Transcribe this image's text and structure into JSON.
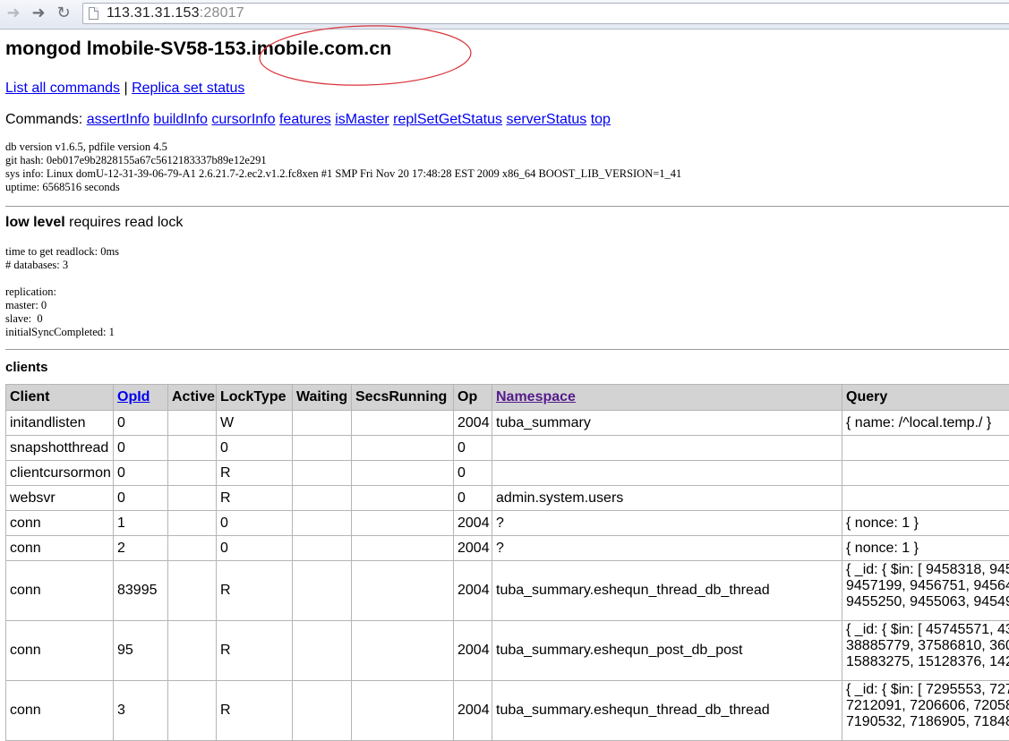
{
  "browser": {
    "url_host": "113.31.31.153",
    "url_port": ":28017",
    "icons": [
      "back-arrow-icon",
      "forward-arrow-icon",
      "reload-icon",
      "page-icon"
    ]
  },
  "page": {
    "title": "mongod lmobile-SV58-153.imobile.com.cn",
    "links": {
      "list_all_commands": "List all commands",
      "separator": " | ",
      "replica_set_status": "Replica set status"
    },
    "commands_label": "Commands: ",
    "commands": [
      "assertInfo",
      "buildInfo",
      "cursorInfo",
      "features",
      "isMaster",
      "replSetGetStatus",
      "serverStatus",
      "top"
    ],
    "sysinfo": "db version v1.6.5, pdfile version 4.5\ngit hash: 0eb017e9b2828155a67c5612183337b89e12e291\nsys info: Linux domU-12-31-39-06-79-A1 2.6.21.7-2.ec2.v1.2.fc8xen #1 SMP Fri Nov 20 17:48:28 EST 2009 x86_64 BOOST_LIB_VERSION=1_41\nuptime: 6568516 seconds",
    "low_level_bold": "low level",
    "low_level_rest": " requires read lock",
    "lockinfo": "time to get readlock: 0ms\n# databases: 3\n\nreplication:\nmaster: 0\nslave:  0\ninitialSyncCompleted: 1",
    "clients_title": "clients"
  },
  "clients_table": {
    "headers": {
      "client": "Client",
      "opid": "OpId",
      "active": "Active",
      "locktype": "LockType",
      "waiting": "Waiting",
      "secsrunning": "SecsRunning",
      "op": "Op",
      "namespace": "Namespace",
      "query": "Query"
    },
    "rows": [
      {
        "client": "initandlisten",
        "opid": "0",
        "active": "",
        "locktype": "W",
        "waiting": "",
        "secsrunning": "",
        "op": "2004",
        "namespace": "tuba_summary",
        "query": "{ name: /^local.temp./ }"
      },
      {
        "client": "snapshotthread",
        "opid": "0",
        "active": "",
        "locktype": "0",
        "waiting": "",
        "secsrunning": "",
        "op": "0",
        "namespace": "",
        "query": ""
      },
      {
        "client": "clientcursormon",
        "opid": "0",
        "active": "",
        "locktype": "R",
        "waiting": "",
        "secsrunning": "",
        "op": "0",
        "namespace": "",
        "query": ""
      },
      {
        "client": "websvr",
        "opid": "0",
        "active": "",
        "locktype": "R",
        "waiting": "",
        "secsrunning": "",
        "op": "0",
        "namespace": "admin.system.users",
        "query": ""
      },
      {
        "client": "conn",
        "opid": "1",
        "active": "",
        "locktype": "0",
        "waiting": "",
        "secsrunning": "",
        "op": "2004",
        "namespace": "?",
        "query": "{ nonce: 1 }"
      },
      {
        "client": "conn",
        "opid": "2",
        "active": "",
        "locktype": "0",
        "waiting": "",
        "secsrunning": "",
        "op": "2004",
        "namespace": "?",
        "query": "{ nonce: 1 }"
      },
      {
        "client": "conn",
        "opid": "83995",
        "active": "",
        "locktype": "R",
        "waiting": "",
        "secsrunning": "",
        "op": "2004",
        "namespace": "tuba_summary.eshequn_thread_db_thread",
        "query": "{ _id: { $in: [ 9458318, 945\n9457199, 9456751, 94564\n9455250, 9455063, 94549"
      },
      {
        "client": "conn",
        "opid": "95",
        "active": "",
        "locktype": "R",
        "waiting": "",
        "secsrunning": "",
        "op": "2004",
        "namespace": "tuba_summary.eshequn_post_db_post",
        "query": "{ _id: { $in: [ 45745571, 43\n38885779, 37586810, 360\n15883275, 15128376, 142"
      },
      {
        "client": "conn",
        "opid": "3",
        "active": "",
        "locktype": "R",
        "waiting": "",
        "secsrunning": "",
        "op": "2004",
        "namespace": "tuba_summary.eshequn_thread_db_thread",
        "query": "{ _id: { $in: [ 7295553, 727\n7212091, 7206606, 72058\n7190532, 7186905, 71848"
      }
    ]
  },
  "colors": {
    "link": "#0000ee",
    "visited_link": "#551a8b",
    "header_bg": "#d3d3d3",
    "annotation": "#d9333a"
  }
}
